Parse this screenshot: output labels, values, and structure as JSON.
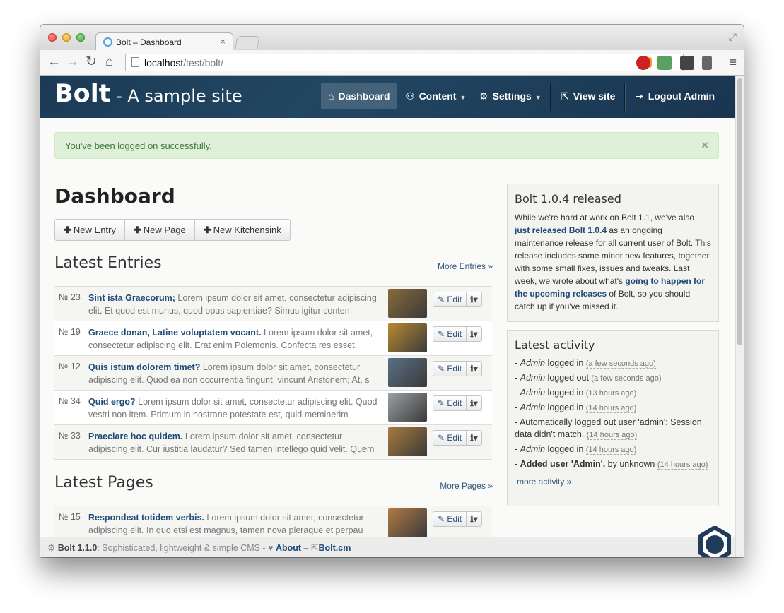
{
  "browser": {
    "tab_title": "Bolt – Dashboard",
    "tab_close": "×",
    "url_host": "localhost",
    "url_path": "/test/bolt/"
  },
  "header": {
    "brand_name": "Bolt",
    "brand_tagline": " - A sample site",
    "nav": {
      "dashboard": "Dashboard",
      "content": "Content",
      "settings": "Settings",
      "view_site": "View site",
      "logout": "Logout Admin"
    }
  },
  "alert": {
    "message": "You've been logged on successfully.",
    "close": "×"
  },
  "page": {
    "title": "Dashboard",
    "buttons": [
      "New Entry",
      "New Page",
      "New Kitchensink"
    ]
  },
  "latest_entries": {
    "title": "Latest Entries",
    "more": "More Entries »",
    "rows": [
      {
        "num": "№ 23",
        "title": "Sint ista Graecorum;",
        "text": " Lorem ipsum dolor sit amet, consectetur adipiscing elit. Et quod est munus, quod opus sapientiae? Simus igitur conten",
        "thumb": "#8a6a3a"
      },
      {
        "num": "№ 19",
        "title": "Graece donan, Latine voluptatem vocant.",
        "text": " Lorem ipsum dolor sit amet, consectetur adipiscing elit. Erat enim Polemonis. Confecta res esset.",
        "thumb": "#b88a2e"
      },
      {
        "num": "№ 12",
        "title": "Quis istum dolorem timet?",
        "text": " Lorem ipsum dolor sit amet, consectetur adipiscing elit. Quod ea non occurrentia fingunt, vincunt Aristonem; At, s",
        "thumb": "#5a7085"
      },
      {
        "num": "№ 34",
        "title": "Quid ergo?",
        "text": " Lorem ipsum dolor sit amet, consectetur adipiscing elit. Quod vestri non item. Primum in nostrane potestate est, quid meminerim",
        "thumb": "#9aa0a4"
      },
      {
        "num": "№ 33",
        "title": "Praeclare hoc quidem.",
        "text": " Lorem ipsum dolor sit amet, consectetur adipiscing elit. Cur iustitia laudatur? Sed tamen intellego quid velit. Quem Ti",
        "thumb": "#a87a3c"
      }
    ]
  },
  "latest_pages": {
    "title": "Latest Pages",
    "more": "More Pages »",
    "rows": [
      {
        "num": "№ 15",
        "title": "Respondeat totidem verbis.",
        "text": " Lorem ipsum dolor sit amet, consectetur adipiscing elit. In quo etsi est magnus, tamen nova pleraque et perpau",
        "thumb": "#b07a45"
      }
    ]
  },
  "row_actions": {
    "edit": "Edit"
  },
  "news": {
    "title": "Bolt 1.0.4 released",
    "text_1": "While we're hard at work on Bolt 1.1, we've also ",
    "link_1": "just released Bolt 1.0.4",
    "text_2": " as an ongoing maintenance release for all current user of Bolt. This release includes some minor new features, together with some small fixes, issues and tweaks. Last week, we wrote about what's ",
    "link_2": "going to happen for the upcoming releases",
    "text_3": " of Bolt, so you should catch up if you've missed it."
  },
  "activity": {
    "title": "Latest activity",
    "items": [
      {
        "who": "Admin",
        "action": " logged in ",
        "when": "(a few seconds ago)"
      },
      {
        "who": "Admin",
        "action": " logged out ",
        "when": "(a few seconds ago)"
      },
      {
        "who": "Admin",
        "action": " logged in ",
        "when": "(13 hours ago)"
      },
      {
        "who": "Admin",
        "action": " logged in ",
        "when": "(14 hours ago)"
      },
      {
        "who": "",
        "action": "Automatically logged out user 'admin': Session data didn't match. ",
        "when": "(14 hours ago)"
      },
      {
        "who": "Admin",
        "action": " logged in ",
        "when": "(14 hours ago)"
      },
      {
        "strong": "Added user 'Admin'.",
        "action": " by unknown ",
        "when": "(14 hours ago)"
      }
    ],
    "more": "more activity »"
  },
  "footer": {
    "version": "Bolt 1.1.0",
    "tagline": ": Sophisticated, lightweight & simple CMS - ",
    "about": "About",
    "dash": " – ",
    "site": "Bolt.cm"
  }
}
